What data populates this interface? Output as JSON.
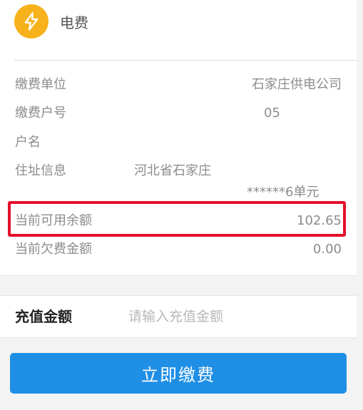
{
  "header": {
    "title": "电费",
    "icon": "lightning-bolt-icon"
  },
  "info": {
    "unit_label": "缴费单位",
    "unit_value": "石家庄供电公司",
    "account_label": "缴费户号",
    "account_value": "05",
    "name_label": "户名",
    "address_label": "住址信息",
    "address_line1": "河北省石家庄",
    "address_line2": "******6单元",
    "balance_label": "当前可用余额",
    "balance_value": "102.65",
    "arrears_label": "当前欠费金额",
    "arrears_value": "0.00"
  },
  "recharge": {
    "label": "充值金额",
    "placeholder": "请输入充值金额"
  },
  "pay_button": {
    "label": "立即缴费"
  },
  "colors": {
    "accent": "#1f8fe6",
    "icon": "#f7b21b",
    "highlight": "#e2102a"
  }
}
